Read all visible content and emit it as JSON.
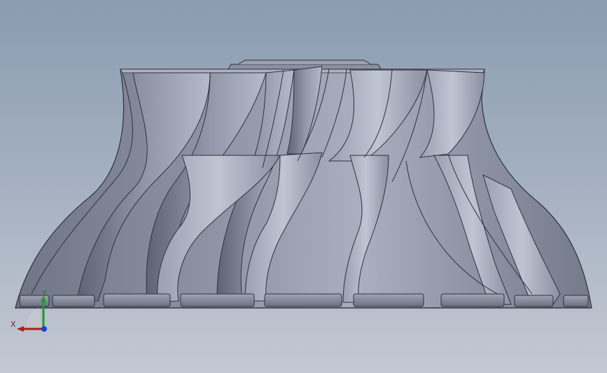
{
  "viewport": {
    "background_top": "#8b9bb0",
    "background_bottom": "#c3c8d2"
  },
  "model": {
    "part": "impeller",
    "body_color": "#7f8596",
    "highlight_color": "#b7bdcc",
    "edge_color": "#2e323c",
    "blade_count": 14
  },
  "triad": {
    "x_label": "X",
    "y_label": "Y",
    "x_color": "#b01b1b",
    "y_color": "#1f9a2a",
    "z_color": "#1d3fd6"
  }
}
